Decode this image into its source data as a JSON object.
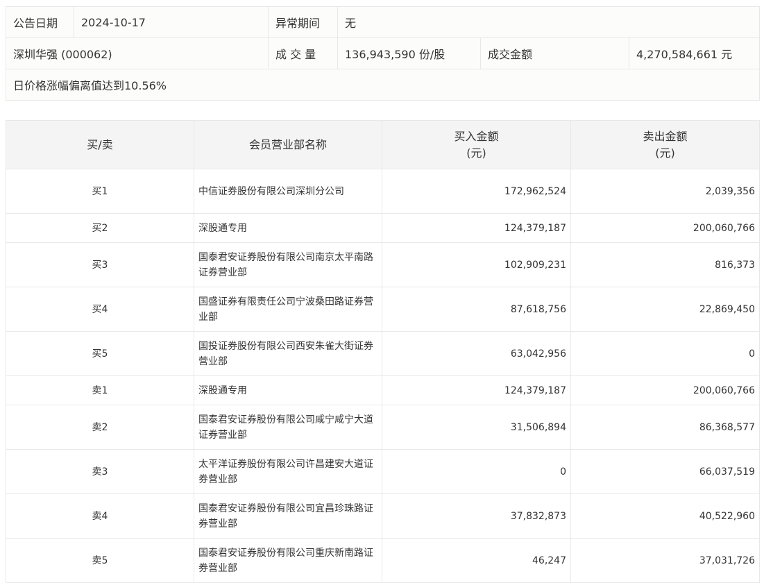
{
  "info": {
    "date_label": "公告日期",
    "date": "2024-10-17",
    "period_label": "异常期间",
    "period": "无",
    "stock": "深圳华强 (000062)",
    "volume_label": "成 交 量",
    "volume": "136,943,590 份/股",
    "amount_label": "成交金额",
    "amount": "4,270,584,661 元",
    "reason": "日价格涨幅偏离值达到10.56%"
  },
  "table": {
    "headers": [
      "买/卖",
      "会员营业部名称",
      "买入金额",
      "(元)",
      "卖出金额",
      "(元)"
    ],
    "rows": [
      {
        "side": "买1",
        "name": "中信证券股份有限公司深圳分公司",
        "buy": "172,962,524",
        "sell": "2,039,356"
      },
      {
        "side": "买2",
        "name": "深股通专用",
        "buy": "124,379,187",
        "sell": "200,060,766"
      },
      {
        "side": "买3",
        "name": "国泰君安证券股份有限公司南京太平南路证券营业部",
        "buy": "102,909,231",
        "sell": "816,373"
      },
      {
        "side": "买4",
        "name": "国盛证券有限责任公司宁波桑田路证券营业部",
        "buy": "87,618,756",
        "sell": "22,869,450"
      },
      {
        "side": "买5",
        "name": "国投证券股份有限公司西安朱雀大街证券营业部",
        "buy": "63,042,956",
        "sell": "0"
      },
      {
        "side": "卖1",
        "name": "深股通专用",
        "buy": "124,379,187",
        "sell": "200,060,766"
      },
      {
        "side": "卖2",
        "name": "国泰君安证券股份有限公司咸宁咸宁大道证券营业部",
        "buy": "31,506,894",
        "sell": "86,368,577"
      },
      {
        "side": "卖3",
        "name": "太平洋证券股份有限公司许昌建安大道证券营业部",
        "buy": "0",
        "sell": "66,037,519"
      },
      {
        "side": "卖4",
        "name": "国泰君安证券股份有限公司宜昌珍珠路证券营业部",
        "buy": "37,832,873",
        "sell": "40,522,960"
      },
      {
        "side": "卖5",
        "name": "国泰君安证券股份有限公司重庆新南路证券营业部",
        "buy": "46,247",
        "sell": "37,031,726"
      }
    ]
  }
}
